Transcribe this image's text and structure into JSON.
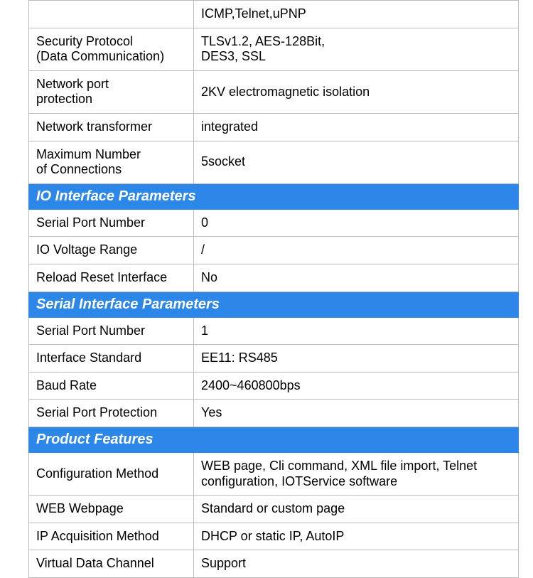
{
  "rows": [
    {
      "type": "partial",
      "label": "",
      "value": "ICMP,Telnet,uPNP"
    },
    {
      "type": "row",
      "label": "Security Protocol\n(Data Communication)",
      "value": "TLSv1.2, AES-128Bit,\nDES3, SSL"
    },
    {
      "type": "row",
      "label": "Network port\nprotection",
      "value": "2KV electromagnetic isolation"
    },
    {
      "type": "row",
      "label": "Network transformer",
      "value": "integrated"
    },
    {
      "type": "row",
      "label": "Maximum Number\nof Connections",
      "value": "5socket"
    },
    {
      "type": "header",
      "label": "IO Interface Parameters"
    },
    {
      "type": "row",
      "label": "Serial Port Number",
      "value": "0"
    },
    {
      "type": "row",
      "label": "IO Voltage Range",
      "value": "/"
    },
    {
      "type": "row",
      "label": "Reload Reset Interface",
      "value": "No"
    },
    {
      "type": "header",
      "label": "Serial Interface Parameters"
    },
    {
      "type": "row",
      "label": "Serial Port Number",
      "value": "1"
    },
    {
      "type": "row",
      "label": "Interface Standard",
      "value": "EE11: RS485"
    },
    {
      "type": "row",
      "label": "Baud Rate",
      "value": "2400~460800bps"
    },
    {
      "type": "row",
      "label": "Serial Port Protection",
      "value": "Yes"
    },
    {
      "type": "header",
      "label": "Product Features"
    },
    {
      "type": "row",
      "label": "Configuration Method",
      "value": "WEB page, Cli command, XML file import, Telnet configuration, IOTService software"
    },
    {
      "type": "row",
      "label": "WEB Webpage",
      "value": "Standard or custom page"
    },
    {
      "type": "row",
      "label": "IP Acquisition Method",
      "value": "DHCP or static IP, AutoIP"
    },
    {
      "type": "row",
      "label": "Virtual Data Channel",
      "value": "Support"
    }
  ]
}
